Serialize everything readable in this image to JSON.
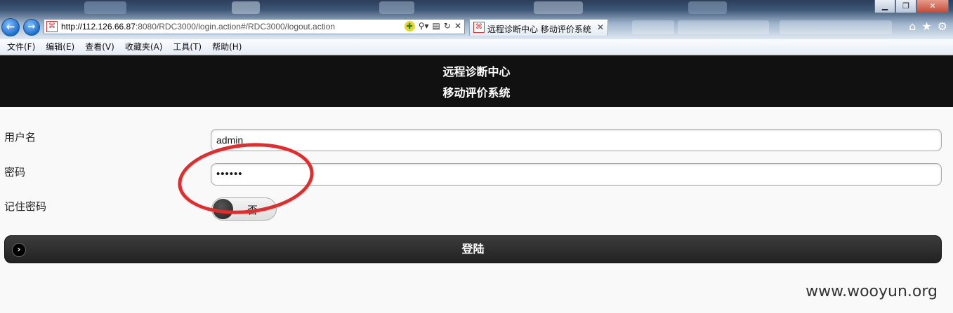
{
  "browser": {
    "url_host": "http://112.126.66.87",
    "url_rest": ":8080/RDC3000/login.action#/RDC3000/logout.action",
    "tab_title": "远程诊断中心 移动评价系统",
    "site_icon": "jboss-icon",
    "window_controls": [
      "minimize",
      "restore",
      "close"
    ],
    "menu": [
      "文件(F)",
      "编辑(E)",
      "查看(V)",
      "收藏夹(A)",
      "工具(T)",
      "帮助(H)"
    ]
  },
  "page": {
    "header_line1": "远程诊断中心",
    "header_line2": "移动评价系统",
    "username_label": "用户名",
    "username_value": "admin",
    "password_label": "密码",
    "password_value": "••••••",
    "remember_label": "记住密码",
    "remember_toggle": "否",
    "login_button": "登陆"
  },
  "watermark": "www.wooyun.org",
  "colors": {
    "header_bg": "#111111",
    "annotation": "#e52c2c"
  }
}
